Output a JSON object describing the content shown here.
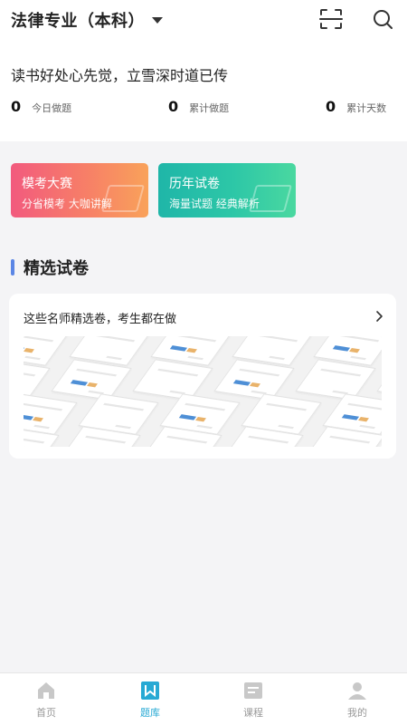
{
  "header": {
    "subject_title": "法律专业（本科）"
  },
  "motto": "读书好处心先觉，立雪深时道已传",
  "stats": [
    {
      "value": "0",
      "label": "今日做题"
    },
    {
      "value": "0",
      "label": "累计做题"
    },
    {
      "value": "0",
      "label": "累计天数"
    }
  ],
  "entries": [
    {
      "title": "模考大赛",
      "subtitle": "分省模考 大咖讲解"
    },
    {
      "title": "历年试卷",
      "subtitle": "海量试题 经典解析"
    }
  ],
  "section": {
    "heading": "精选试卷",
    "card_title": "这些名师精选卷，考生都在做"
  },
  "tabbar": {
    "items": [
      {
        "label": "首页",
        "icon": "home-icon"
      },
      {
        "label": "题库",
        "icon": "question-bank-icon",
        "active": true
      },
      {
        "label": "课程",
        "icon": "course-icon"
      },
      {
        "label": "我的",
        "icon": "profile-icon"
      }
    ]
  },
  "colors": {
    "accent": "#27a9d4",
    "mock_gradient_start": "#f25a7e",
    "mock_gradient_end": "#f9a25a",
    "past_gradient_start": "#1fb6a8",
    "past_gradient_end": "#4ad8a0",
    "heading_bar": "#5b86e5"
  }
}
